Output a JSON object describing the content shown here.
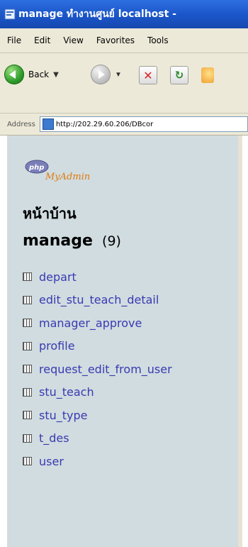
{
  "window": {
    "title": "manage ทำงานศูนย์ localhost -"
  },
  "menu": [
    "File",
    "Edit",
    "View",
    "Favorites",
    "Tools"
  ],
  "toolbar": {
    "back_label": "Back"
  },
  "address": {
    "label": "Address",
    "url": "http://202.29.60.206/DBcor"
  },
  "pma": {
    "logo_text_1": "php",
    "logo_text_2": "MyAdmin",
    "home_label": "หน้าบ้าน",
    "db_name": "manage",
    "db_count": "(9)",
    "tables": [
      "depart",
      "edit_stu_teach_detail",
      "manager_approve",
      "profile",
      "request_edit_from_user",
      "stu_teach",
      "stu_type",
      "t_des",
      "user"
    ]
  },
  "colors": {
    "frame_bg": "#d0dce0",
    "link": "#3a3ab0",
    "titlebar": "#1a55c8"
  }
}
